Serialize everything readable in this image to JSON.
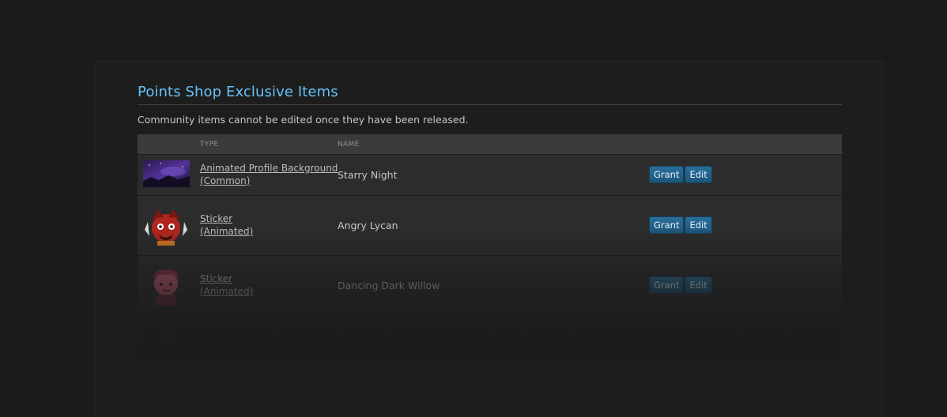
{
  "section": {
    "title": "Points Shop Exclusive Items",
    "description": "Community items cannot be edited once they have been released."
  },
  "table": {
    "headers": {
      "thumb": "",
      "type": "TYPE",
      "name": "NAME"
    },
    "rows": [
      {
        "type_line1": "Animated Profile Background",
        "type_line2": "(Common)",
        "name": "Starry Night",
        "grant": "Grant",
        "edit": "Edit"
      },
      {
        "type_line1": "Sticker",
        "type_line2": "(Animated)",
        "name": "Angry Lycan",
        "grant": "Grant",
        "edit": "Edit"
      },
      {
        "type_line1": "Sticker",
        "type_line2": "(Animated)",
        "name": "Dancing Dark Willow",
        "grant": "Grant",
        "edit": "Edit"
      }
    ]
  },
  "colors": {
    "background": "#1b1b1c",
    "title": "#67c1f5",
    "button": "#1c5579",
    "row": "#2c2c2d",
    "header": "#3b3b3c"
  }
}
